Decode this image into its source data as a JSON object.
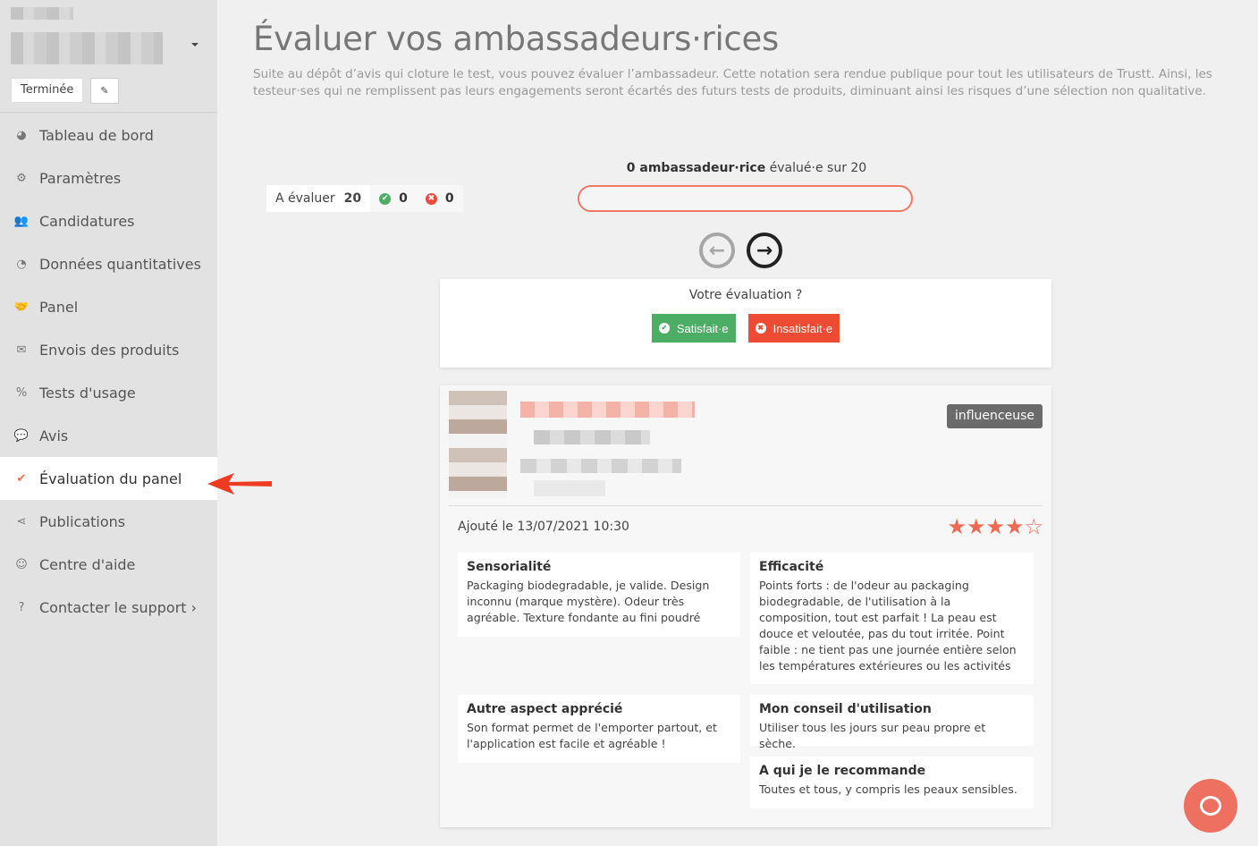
{
  "sidebar": {
    "status_label": "Terminée",
    "edit_icon": "edit-icon",
    "items": [
      {
        "icon": "dashboard-icon",
        "glyph": "◕",
        "label": "Tableau de bord"
      },
      {
        "icon": "cogs-icon",
        "glyph": "⚙",
        "label": "Paramètres"
      },
      {
        "icon": "users-icon",
        "glyph": "👥",
        "label": "Candidatures"
      },
      {
        "icon": "pie-chart-icon",
        "glyph": "◔",
        "label": "Données quantitatives"
      },
      {
        "icon": "handshake-icon",
        "glyph": "🤝",
        "label": "Panel"
      },
      {
        "icon": "envelope-icon",
        "glyph": "✉",
        "label": "Envois des produits"
      },
      {
        "icon": "percent-icon",
        "glyph": "%",
        "label": "Tests d'usage"
      },
      {
        "icon": "comments-icon",
        "glyph": "💬",
        "label": "Avis"
      },
      {
        "icon": "check-circle-icon",
        "glyph": "✔",
        "label": "Évaluation du panel",
        "active": true
      },
      {
        "icon": "share-icon",
        "glyph": "⋖",
        "label": "Publications"
      },
      {
        "icon": "smile-icon",
        "glyph": "☺",
        "label": "Centre d'aide"
      },
      {
        "icon": "question-circle-icon",
        "glyph": "?",
        "label": "Contacter le support ›"
      }
    ]
  },
  "main": {
    "title": "Évaluer vos ambassadeurs·rices",
    "intro": "Suite au dépôt d’avis qui cloture le test, vous pouvez évaluer l’ambassadeur. Cette notation sera rendue publique pour tout les utilisateurs de Trustt. Ainsi, les testeur·ses qui ne remplissent pas leurs engagements seront écartés des futurs tests de produits, diminuant ainsi les risques d’une sélection non qualitative.",
    "counters": {
      "to_evaluate_label": "A évaluer",
      "to_evaluate_count": "20",
      "satisfied_count": "0",
      "unsatisfied_count": "0"
    },
    "progress": {
      "count_bold": "0 ambassadeur·rice",
      "rest": " évalué·e sur 20",
      "value": 0
    },
    "evaluation": {
      "question": "Votre évaluation ?",
      "satisfied_label": "Satisfait·e",
      "unsatisfied_label": "Insatisfait·e"
    },
    "review": {
      "badge": "influenceuse",
      "added": "Ajouté le 13/07/2021 10:30",
      "rating": 4,
      "rating_max": 5,
      "sections": [
        {
          "title": "Sensorialité",
          "text": "Packaging biodegradable, je valide. Design inconnu (marque mystère). Odeur très agréable. Texture fondante au fini poudré"
        },
        {
          "title": "Efficacité",
          "text": "Points forts : de l'odeur au packaging biodegradable, de l'utilisation à la composition, tout est parfait ! La peau est douce et veloutée, pas du tout irritée. Point faible : ne tient pas une journée entière selon les températures extérieures ou les activités"
        },
        {
          "title": "Autre aspect apprécié",
          "text": "Son format permet de l'emporter partout, et l'application est facile et agréable !"
        },
        {
          "title": "Mon conseil d'utilisation",
          "text": "Utiliser tous les jours sur peau propre et sèche."
        },
        {
          "title": "A qui je le recommande",
          "text": "Toutes et tous, y compris les peaux sensibles."
        }
      ]
    }
  },
  "colors": {
    "accent": "#ee6a52",
    "success": "#4cae64",
    "danger": "#ee4b35"
  }
}
